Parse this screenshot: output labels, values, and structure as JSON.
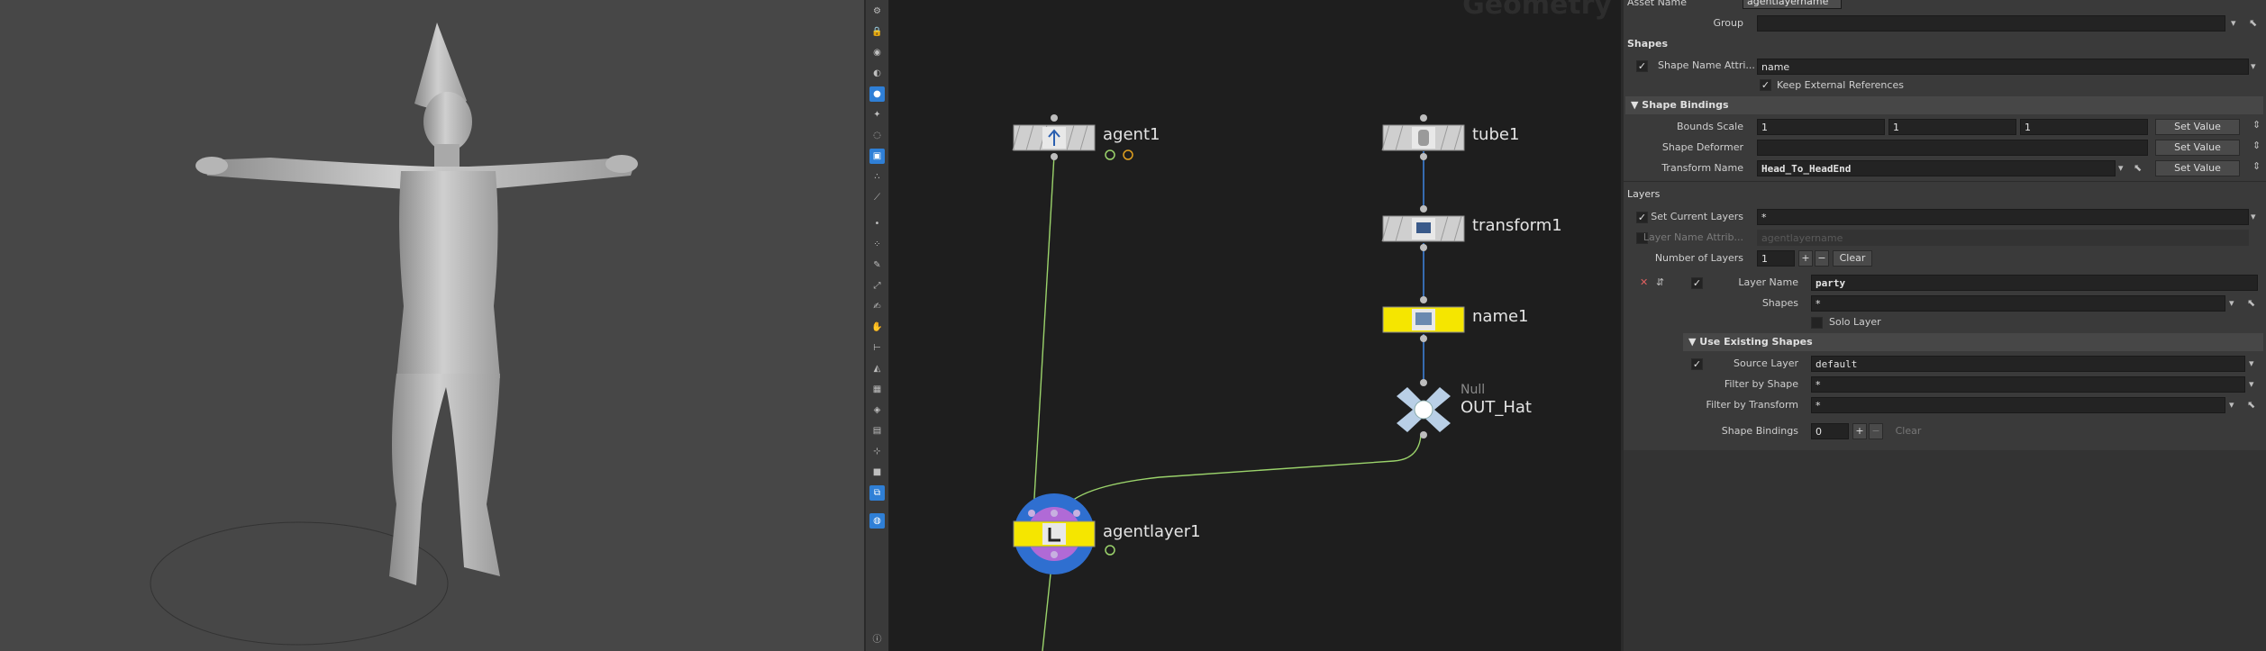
{
  "network": {
    "context_title": "Geometry",
    "nodes": [
      {
        "id": "agent1",
        "name": "agent1"
      },
      {
        "id": "tube1",
        "name": "tube1"
      },
      {
        "id": "transform1",
        "name": "transform1"
      },
      {
        "id": "name1",
        "name": "name1"
      },
      {
        "id": "out_hat",
        "name": "OUT_Hat",
        "type": "Null"
      },
      {
        "id": "agentlayer1",
        "name": "agentlayer1"
      }
    ]
  },
  "params": {
    "asset_name_label": "Asset Name",
    "asset_name_value": "agentlayername",
    "group_label": "Group",
    "group_value": "",
    "shapes_section": "Shapes",
    "shape_name_attr_label": "Shape Name Attri...",
    "shape_name_attr_value": "name",
    "keep_external_label": "Keep External References",
    "shape_bindings_section": "Shape Bindings",
    "bounds_scale_label": "Bounds Scale",
    "bounds_scale": [
      "1",
      "1",
      "1"
    ],
    "shape_deformer_label": "Shape Deformer",
    "transform_name_label": "Transform Name",
    "transform_name_value": "Head_To_HeadEnd",
    "set_value_label": "Set Value",
    "layers_section": "Layers",
    "set_current_layers_label": "Set Current Layers",
    "set_current_layers_value": "*",
    "layer_name_attr_label": "Layer Name Attrib...",
    "layer_name_attr_value": "agentlayername",
    "num_layers_label": "Number of Layers",
    "num_layers_value": "1",
    "clear_label": "Clear",
    "layer_name_label": "Layer Name",
    "layer_name_value": "party",
    "shapes_label": "Shapes",
    "shapes_value": "*",
    "solo_layer_label": "Solo Layer",
    "use_existing_section": "Use Existing Shapes",
    "source_layer_label": "Source Layer",
    "source_layer_value": "default",
    "filter_shape_label": "Filter by Shape",
    "filter_shape_value": "*",
    "filter_transform_label": "Filter by Transform",
    "filter_transform_value": "*",
    "shape_bindings_label": "Shape Bindings",
    "shape_bindings_value": "0",
    "plus": "+",
    "minus": "−"
  },
  "colors": {
    "accent": "#2f7fd6",
    "display_flag": "#f5e600",
    "wire_green": "#9bd36b",
    "wire_blue": "#3d7fd6"
  }
}
